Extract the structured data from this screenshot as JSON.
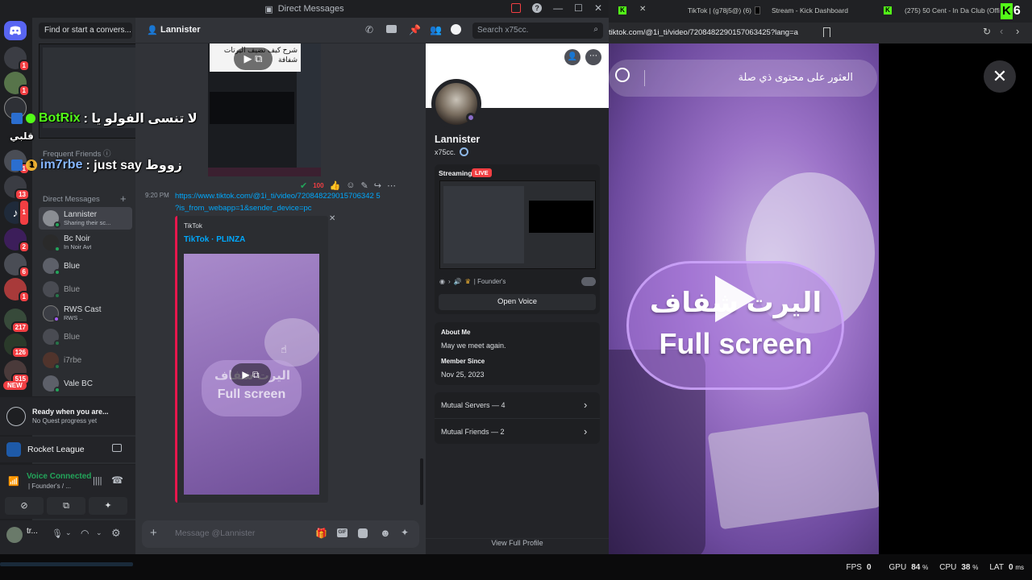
{
  "discord": {
    "window_title": "Direct Messages",
    "find_placeholder": "Find or start a convers...",
    "frequent_friends": "Frequent Friends",
    "direct_messages": "Direct Messages",
    "dms": [
      {
        "name": "Lannister",
        "sub": "Sharing their sc..."
      },
      {
        "name": "Bc Noir",
        "sub": "In Noir Avt"
      },
      {
        "name": "Blue",
        "sub": ""
      },
      {
        "name": "Blue",
        "sub": ""
      },
      {
        "name": "RWS Cast",
        "sub": "RWS .."
      },
      {
        "name": "Blue",
        "sub": ""
      },
      {
        "name": "i7rbe",
        "sub": ""
      },
      {
        "name": "Vale BC",
        "sub": ""
      }
    ],
    "guild_badges": [
      "1",
      "1",
      "1",
      "1",
      "13",
      "1",
      "2",
      "6",
      "1",
      "217",
      "126",
      "515"
    ],
    "new_badge": "NEW",
    "quest_title": "Ready when you are...",
    "quest_sub": "No Quest progress yet",
    "activity": "Rocket League",
    "voice_status": "Voice Connected",
    "voice_channel": "| Founder's / ...",
    "user_name": "tr...",
    "chat_header_name": "Lannister",
    "search_placeholder": "Search x75cc.",
    "message": {
      "time": "9:20 PM",
      "link_line1": "https://www.tiktok.com/@1i_ti/video/720848229015706342 5",
      "link_line2": "?is_from_webapp=1&sender_device=pc",
      "embed_provider": "TikTok",
      "embed_title": "TikTok · PLINZA",
      "video_overlay_arabic": "اليرت شفاف",
      "video_overlay_en": "Full screen"
    },
    "image_arabic_line1": "شرح كيف تضيف اليرتات",
    "image_arabic_line2": "شفافة",
    "composer_placeholder": "Message @Lannister",
    "profile": {
      "name": "Lannister",
      "handle": "x75cc.",
      "streaming": "Streaming",
      "live": "LIVE",
      "stream_channel": "| Founder's",
      "open_voice": "Open Voice",
      "about_title": "About Me",
      "about_text": "May we meet again.",
      "member_since_title": "Member Since",
      "member_since": "Nov 25, 2023",
      "mutual_servers": "Mutual Servers — 4",
      "mutual_friends": "Mutual Friends — 2",
      "view_full": "View Full Profile"
    }
  },
  "overlay": {
    "chat1_user": "BotRix",
    "chat1_text": ": لا تنسى الفولو يا",
    "chat2_badge": "1",
    "chat2_user": "im7rbe",
    "chat2_text": ": just say زووط",
    "side_text": "قلبي"
  },
  "browser": {
    "tabs": [
      {
        "label": "TikTok | (g78j5@) (6)"
      },
      {
        "label": "Stream - Kick Dashboard"
      },
      {
        "label": "(275) 50 Cent - In Da Club (Official"
      }
    ],
    "url": "tiktok.com/@1i_ti/video/7208482290157063425?lang=ar",
    "tiktok_search": "العثور على محتوى ذي صلة",
    "video_overlay_arabic": "اليرت شفاف",
    "video_overlay_en": "Full screen",
    "kick_count": "6"
  },
  "status": {
    "fps_label": "FPS",
    "fps_value": "0",
    "gpu_label": "GPU",
    "gpu_value": "84",
    "cpu_label": "CPU",
    "cpu_value": "38",
    "lat_label": "LAT",
    "lat_value": "0"
  },
  "colors": {
    "discord_bg": "#313338",
    "discord_sidebar": "#2b2d31",
    "discord_guilds": "#1e1f22",
    "link": "#00a8fc",
    "live_red": "#f23f43",
    "online_green": "#23a55a",
    "tiktok_purple": "#9d74c9",
    "botrix_green": "#53fc18"
  }
}
